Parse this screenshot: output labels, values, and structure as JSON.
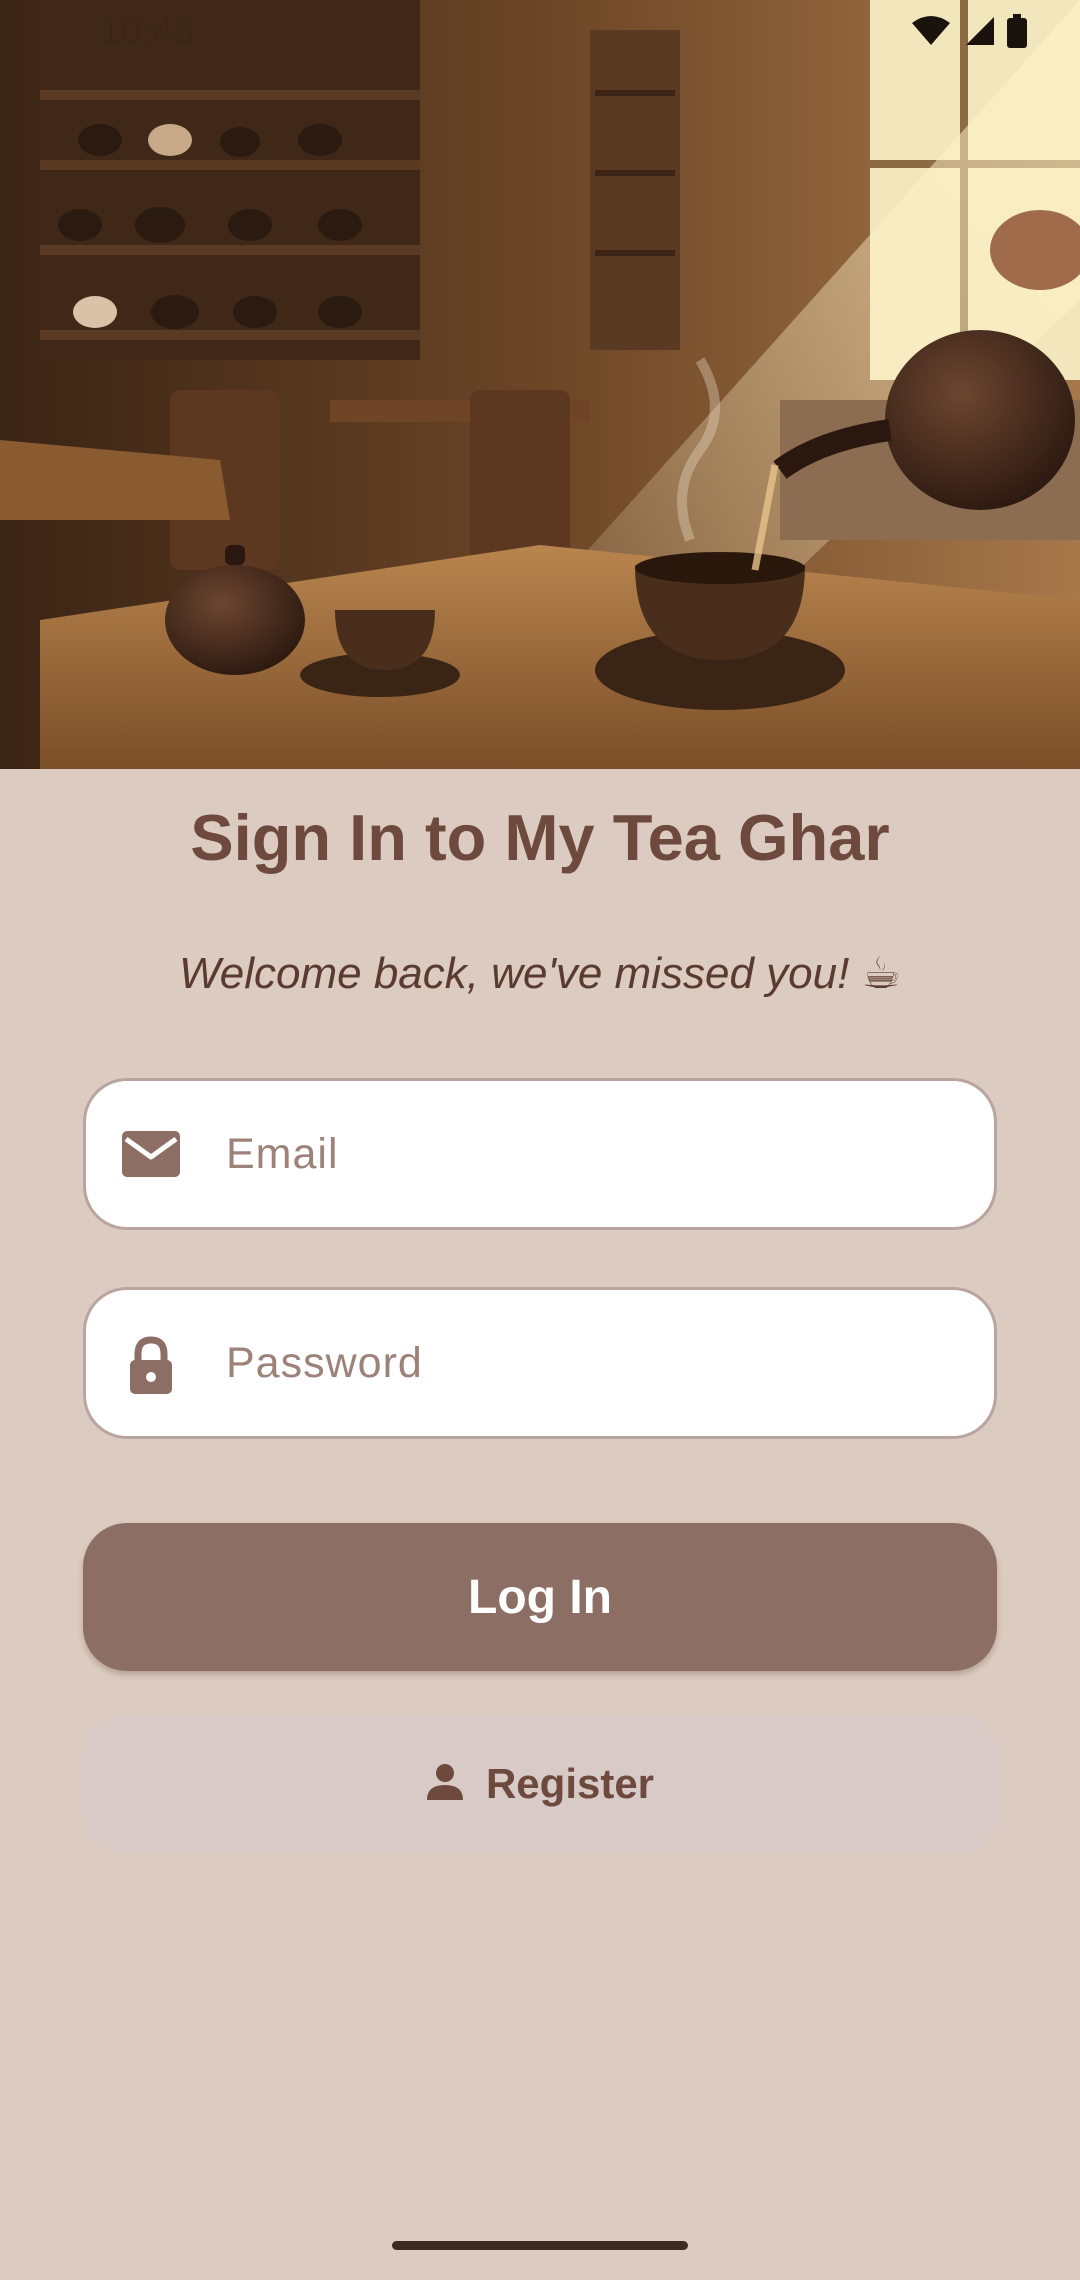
{
  "status_bar": {
    "time": "10:45",
    "icons": [
      "wifi-icon",
      "cellular-signal-icon",
      "battery-icon"
    ]
  },
  "hero": {
    "image": "tea-house-illustration",
    "description_icon": "teapot-pouring-tea-image"
  },
  "login": {
    "title": "Sign In to My Tea Ghar",
    "subtitle": "Welcome back, we've missed you! ☕",
    "email_field": {
      "icon": "mail-icon",
      "placeholder": "Email",
      "value": ""
    },
    "password_field": {
      "icon": "lock-icon",
      "placeholder": "Password",
      "value": ""
    },
    "login_button": "Log In",
    "register_button": {
      "icon": "person-icon",
      "label": "Register"
    }
  },
  "colors": {
    "background": "#dccbc0",
    "title": "#6e4a3e",
    "primary_button": "#8d6e64",
    "secondary_button": "#d8cbc7",
    "field_border": "#b9a59e"
  }
}
